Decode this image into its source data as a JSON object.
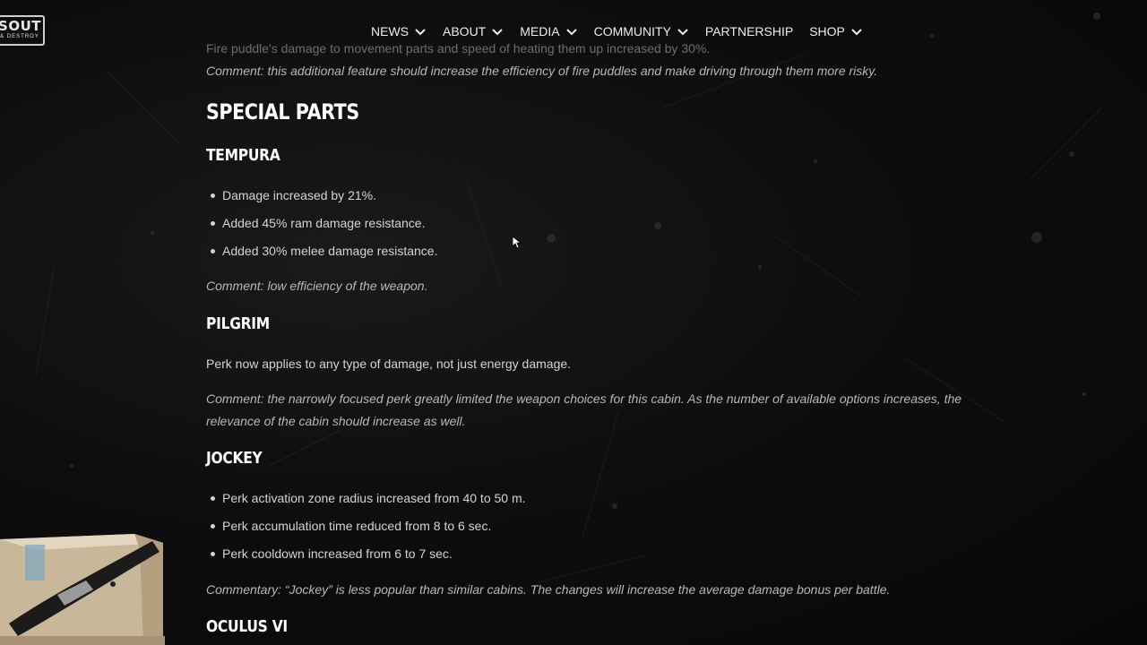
{
  "site": {
    "logo_line1": "SOUT",
    "logo_line2": "& DESTROY"
  },
  "nav": {
    "items": [
      {
        "label": "NEWS",
        "has_dropdown": true
      },
      {
        "label": "ABOUT",
        "has_dropdown": true
      },
      {
        "label": "MEDIA",
        "has_dropdown": true
      },
      {
        "label": "COMMUNITY",
        "has_dropdown": true
      },
      {
        "label": "PARTNERSHIP",
        "has_dropdown": false
      },
      {
        "label": "SHOP",
        "has_dropdown": true
      }
    ]
  },
  "article": {
    "faded_line": "Fire puddle's damage to movement parts and speed of heating them up increased by 30%.",
    "intro_comment": "Comment: this additional feature should increase the efficiency of fire puddles and make driving through them more risky.",
    "section_title": "SPECIAL PARTS",
    "tempura": {
      "title": "TEMPURA",
      "bullets": [
        "Damage increased by 21%.",
        "Added 45% ram damage resistance.",
        "Added 30% melee damage resistance."
      ],
      "comment": "Comment: low efficiency of the weapon."
    },
    "pilgrim": {
      "title": "PILGRIM",
      "text": "Perk now applies to any type of damage, not just energy damage.",
      "comment": "Comment: the narrowly focused perk greatly limited the weapon choices for this cabin. As the number of available options increases, the relevance of the cabin should increase as well."
    },
    "jockey": {
      "title": "JOCKEY",
      "bullets": [
        "Perk activation zone radius increased from 40 to 50 m.",
        "Perk accumulation time reduced from 8 to 6 sec.",
        "Perk cooldown increased from 6 to 7 sec."
      ],
      "comment": "Commentary: “Jockey” is less popular than similar cabins. The changes will increase the average damage bonus per battle."
    },
    "oculus": {
      "title": "OCULUS VI"
    }
  },
  "icons": {
    "dropdown": "chevron-down-icon",
    "cursor": "mouse-pointer-icon",
    "overlay": "cardboard-box-photo"
  },
  "colors": {
    "background": "#0d0d0d",
    "heading": "#ffffff",
    "body_text": "#d4d4d4",
    "comment_text": "#b8b8b8"
  }
}
